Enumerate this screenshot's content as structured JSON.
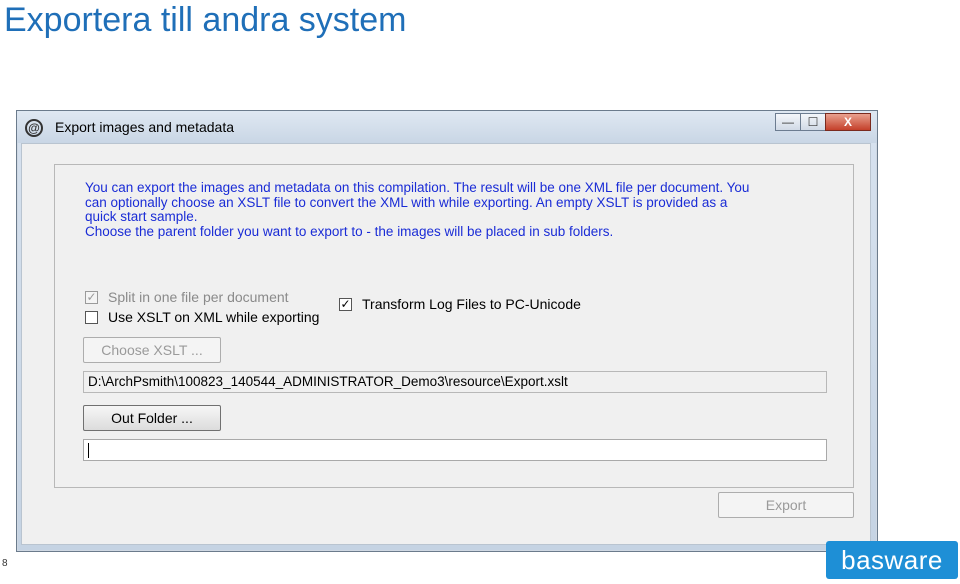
{
  "slide": {
    "title": "Exportera till andra system",
    "page_number": "8",
    "logo_text": "basware"
  },
  "dialog": {
    "title": "Export images and metadata",
    "title_icon": "at-sign-icon",
    "window_buttons": {
      "minimize": "—",
      "maximize": "☐",
      "close": "X"
    },
    "info_lines": [
      "You can export the images and metadata on this compilation. The result will be one XML file per document. You",
      "can optionally choose an XSLT file to convert the XML with while exporting. An empty XSLT is provided as a",
      "quick start sample.",
      "Choose the parent folder you want to export to - the images will be placed in sub folders."
    ],
    "checkboxes": {
      "split": {
        "label": "Split in one file per document",
        "checked": true,
        "disabled": true,
        "mark": "✓"
      },
      "use_xslt": {
        "label": "Use XSLT on XML while exporting",
        "checked": false,
        "disabled": false,
        "mark": ""
      },
      "transform": {
        "label": "Transform Log Files to PC-Unicode",
        "checked": true,
        "disabled": false,
        "mark": "✓"
      }
    },
    "choose_xslt_label": "Choose XSLT ...",
    "xslt_path": "D:\\ArchPsmith\\100823_140544_ADMINISTRATOR_Demo3\\resource\\Export.xslt",
    "out_folder_label": "Out Folder ...",
    "out_folder_value": "",
    "export_label": "Export"
  }
}
